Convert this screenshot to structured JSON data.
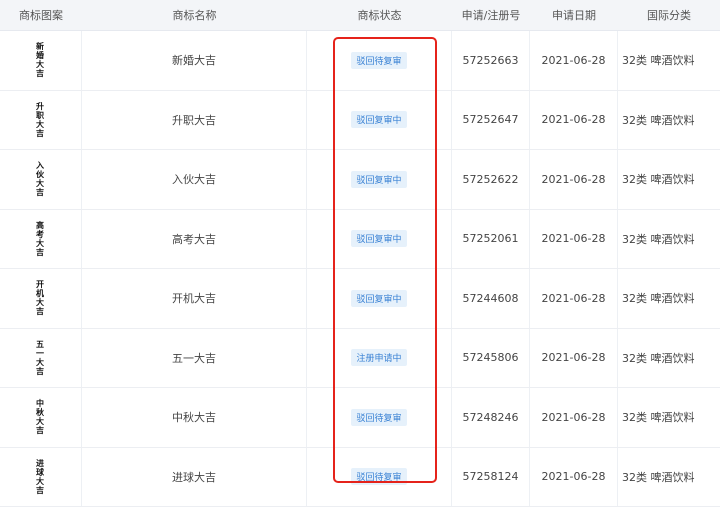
{
  "table": {
    "headers": [
      "商标图案",
      "商标名称",
      "商标状态",
      "申请/注册号",
      "申请日期",
      "国际分类"
    ],
    "rows": [
      {
        "logo_text": "新婚大吉",
        "name": "新婚大吉",
        "status": "驳回待复审",
        "reg_no": "57252663",
        "date": "2021-06-28",
        "class": "32类 啤酒饮料"
      },
      {
        "logo_text": "升职大吉",
        "name": "升职大吉",
        "status": "驳回复审中",
        "reg_no": "57252647",
        "date": "2021-06-28",
        "class": "32类 啤酒饮料"
      },
      {
        "logo_text": "入伙大吉",
        "name": "入伙大吉",
        "status": "驳回复审中",
        "reg_no": "57252622",
        "date": "2021-06-28",
        "class": "32类 啤酒饮料"
      },
      {
        "logo_text": "高考大吉",
        "name": "高考大吉",
        "status": "驳回复审中",
        "reg_no": "57252061",
        "date": "2021-06-28",
        "class": "32类 啤酒饮料"
      },
      {
        "logo_text": "开机大吉",
        "name": "开机大吉",
        "status": "驳回复审中",
        "reg_no": "57244608",
        "date": "2021-06-28",
        "class": "32类 啤酒饮料"
      },
      {
        "logo_text": "五一大吉",
        "name": "五一大吉",
        "status": "注册申请中",
        "reg_no": "57245806",
        "date": "2021-06-28",
        "class": "32类 啤酒饮料"
      },
      {
        "logo_text": "中秋大吉",
        "name": "中秋大吉",
        "status": "驳回待复审",
        "reg_no": "57248246",
        "date": "2021-06-28",
        "class": "32类 啤酒饮料"
      },
      {
        "logo_text": "进球大吉",
        "name": "进球大吉",
        "status": "驳回待复审",
        "reg_no": "57258124",
        "date": "2021-06-28",
        "class": "32类 啤酒饮料"
      }
    ]
  },
  "colors": {
    "header_bg": "#f3f5f8",
    "badge_bg": "#e6f1fb",
    "badge_text": "#3a82d4",
    "highlight_border": "#e5231b"
  }
}
